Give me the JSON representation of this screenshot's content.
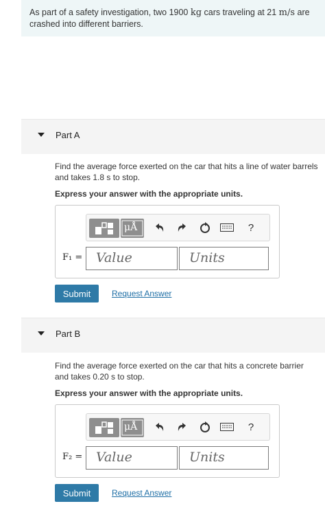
{
  "intro": {
    "text_before_mass": "As part of a safety investigation, two 1900 ",
    "mass_unit": "kg",
    "text_before_speed": " cars traveling at 21 ",
    "speed_unit": "m/s",
    "text_end": " are crashed into different barriers."
  },
  "parts": [
    {
      "title": "Part A",
      "question": "Find the average force exerted on the car that hits a line of water barrels and takes 1.8  s to stop.",
      "instruction": "Express your answer with the appropriate units.",
      "var_label": "F₁ =",
      "value_placeholder": "Value",
      "units_placeholder": "Units",
      "submit_label": "Submit",
      "request_label": "Request Answer"
    },
    {
      "title": "Part B",
      "question": "Find the average force exerted on the car that hits a concrete barrier and takes 0.20  s to stop.",
      "instruction": "Express your answer with the appropriate units.",
      "var_label": "F₂ =",
      "value_placeholder": "Value",
      "units_placeholder": "Units",
      "submit_label": "Submit",
      "request_label": "Request Answer"
    }
  ],
  "toolbar": {
    "mu_label": "μÅ",
    "help_label": "?",
    "icons": [
      "templates-icon",
      "units-icon",
      "undo-icon",
      "redo-icon",
      "reset-icon",
      "keyboard-icon",
      "help-icon"
    ]
  },
  "colors": {
    "intro_bg": "#eef6f7",
    "part_header_bg": "#f4f4f4",
    "submit_bg": "#2e7aa7",
    "link": "#1e6ea5"
  }
}
